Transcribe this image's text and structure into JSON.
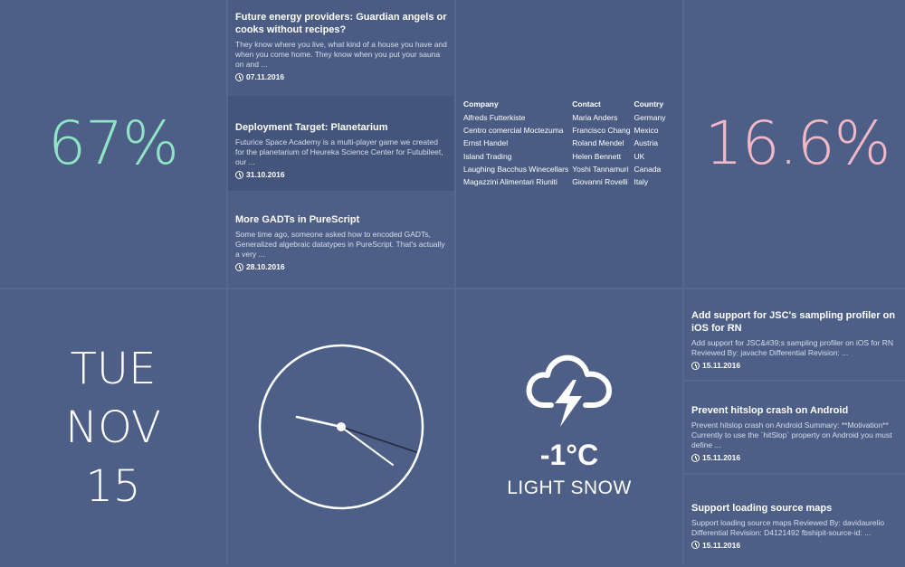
{
  "stats": {
    "left_percent": "67%",
    "left_color": "#8fe6c6",
    "right_percent": "16.6%",
    "right_color": "#f1b8c7"
  },
  "news": [
    {
      "title": "Future energy providers: Guardian angels or cooks without recipes?",
      "body": "They know where you live, what kind of a house you have and when you come home. They know when you put your sauna on and ...",
      "date": "07.11.2016"
    },
    {
      "title": "Deployment Target: Planetarium",
      "body": "Futurice Space Academy is a multi-player game we created for the planetarium of Heureka Science Center for Futubileet, our ...",
      "date": "31.10.2016"
    },
    {
      "title": "More GADTs in PureScript",
      "body": "Some time ago, someone asked how to encoded GADTs, Generalized algebraic datatypes in PureScript. That's actually a very ...",
      "date": "28.10.2016"
    }
  ],
  "table": {
    "headers": [
      "Company",
      "Contact",
      "Country"
    ],
    "rows": [
      [
        "Alfreds Futterkiste",
        "Maria Anders",
        "Germany"
      ],
      [
        "Centro comercial Moctezuma",
        "Francisco Chang",
        "Mexico"
      ],
      [
        "Ernst Handel",
        "Roland Mendel",
        "Austria"
      ],
      [
        "Island Trading",
        "Helen Bennett",
        "UK"
      ],
      [
        "Laughing Bacchus Winecellars",
        "Yoshi Tannamuri",
        "Canada"
      ],
      [
        "Magazzini Alimentari Riuniti",
        "Giovanni Rovelli",
        "Italy"
      ]
    ]
  },
  "date": {
    "weekday": "TUE",
    "month": "NOV",
    "day": "15"
  },
  "weather": {
    "icon": "cloud-lightning-icon",
    "temperature": "-1°C",
    "condition": "LIGHT SNOW"
  },
  "commits": [
    {
      "title": "Add support for JSC's sampling profiler on iOS for RN",
      "body": "Add support for JSC&#39;s sampling profiler on iOS for RN Reviewed By: javache Differential Revision: ...",
      "date": "15.11.2016"
    },
    {
      "title": "Prevent hitslop crash on Android",
      "body": "Prevent hitslop crash on Android Summary: **Motivation** Currently to use the `hitSlop` property on Android you must define ...",
      "date": "15.11.2016"
    },
    {
      "title": "Support loading source maps",
      "body": "Support loading source maps Reviewed By: davidaurelio Differential Revision: D4121492 fbshipit-source-id: ...",
      "date": "15.11.2016"
    }
  ]
}
